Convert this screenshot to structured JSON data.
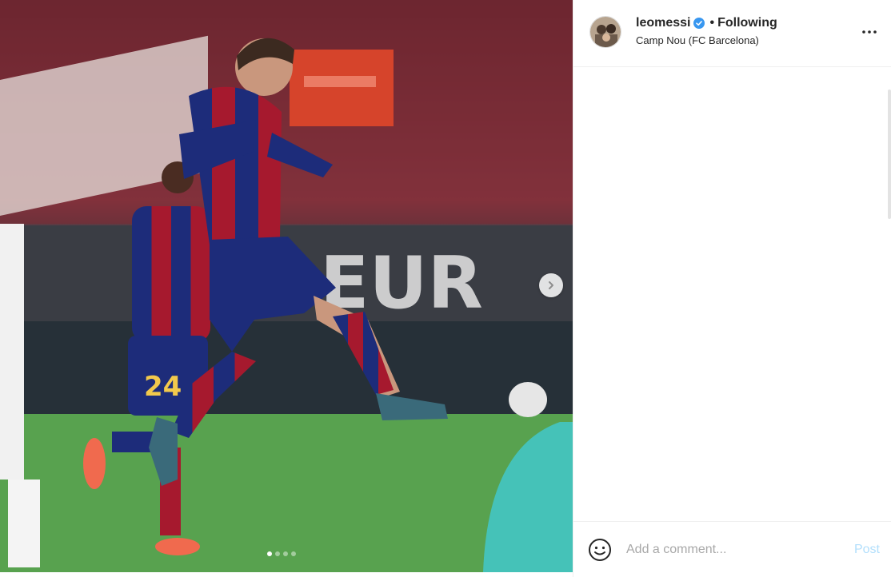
{
  "header": {
    "username": "leomessi",
    "separator": "•",
    "follow_status": "Following",
    "location": "Camp Nou (FC Barcelona)"
  },
  "media": {
    "carousel_count": 4,
    "carousel_active_index": 0,
    "icons": {
      "next": "chevron-right-icon"
    }
  },
  "comment": {
    "placeholder": "Add a comment...",
    "post_label": "Post",
    "icons": {
      "emoji": "emoji-smile-icon"
    }
  },
  "colors": {
    "verified_blue": "#3897f0",
    "post_button_disabled": "#b2dffc",
    "text_primary": "#262626",
    "border": "#efefef"
  }
}
